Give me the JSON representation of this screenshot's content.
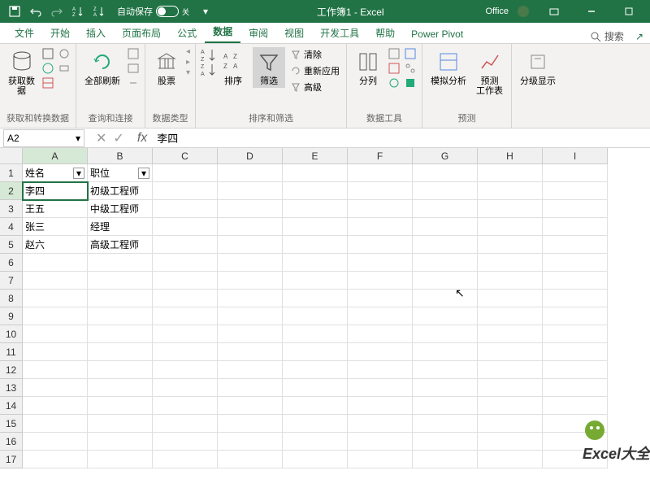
{
  "titlebar": {
    "autosave_label": "自动保存",
    "toggle_state": "关",
    "title": "工作簿1 - Excel",
    "office": "Office"
  },
  "tabs": {
    "items": [
      "文件",
      "开始",
      "插入",
      "页面布局",
      "公式",
      "数据",
      "审阅",
      "视图",
      "开发工具",
      "帮助",
      "Power Pivot"
    ],
    "active": 5,
    "search": "搜索"
  },
  "ribbon": {
    "g0": {
      "label": "获取和转换数据",
      "btn0": "获取数\n据"
    },
    "g1": {
      "label": "查询和连接",
      "btn0": "全部刷新"
    },
    "g2": {
      "label": "数据类型",
      "btn0": "股票"
    },
    "g3": {
      "label": "排序和筛选",
      "sort": "排序",
      "filter": "筛选",
      "clear": "清除",
      "reapply": "重新应用",
      "advanced": "高级"
    },
    "g4": {
      "label": "数据工具",
      "btn0": "分列"
    },
    "g5": {
      "label": "预测",
      "btn0": "模拟分析",
      "btn1": "预测\n工作表"
    },
    "g6": {
      "label": "",
      "btn0": "分级显示"
    }
  },
  "namebox": {
    "ref": "A2"
  },
  "formula": {
    "value": "李四"
  },
  "columns": [
    "A",
    "B",
    "C",
    "D",
    "E",
    "F",
    "G",
    "H",
    "I"
  ],
  "rows": [
    "1",
    "2",
    "3",
    "4",
    "5",
    "6",
    "7",
    "8",
    "9",
    "10",
    "11",
    "12",
    "13",
    "14",
    "15",
    "16",
    "17"
  ],
  "data": {
    "headers": [
      "姓名",
      "职位"
    ],
    "rows": [
      [
        "李四",
        "初级工程师"
      ],
      [
        "王五",
        "中级工程师"
      ],
      [
        "张三",
        "经理"
      ],
      [
        "赵六",
        "高级工程师"
      ]
    ]
  },
  "active_cell": {
    "row": 1,
    "col": 0
  },
  "watermark": "Excel大全"
}
